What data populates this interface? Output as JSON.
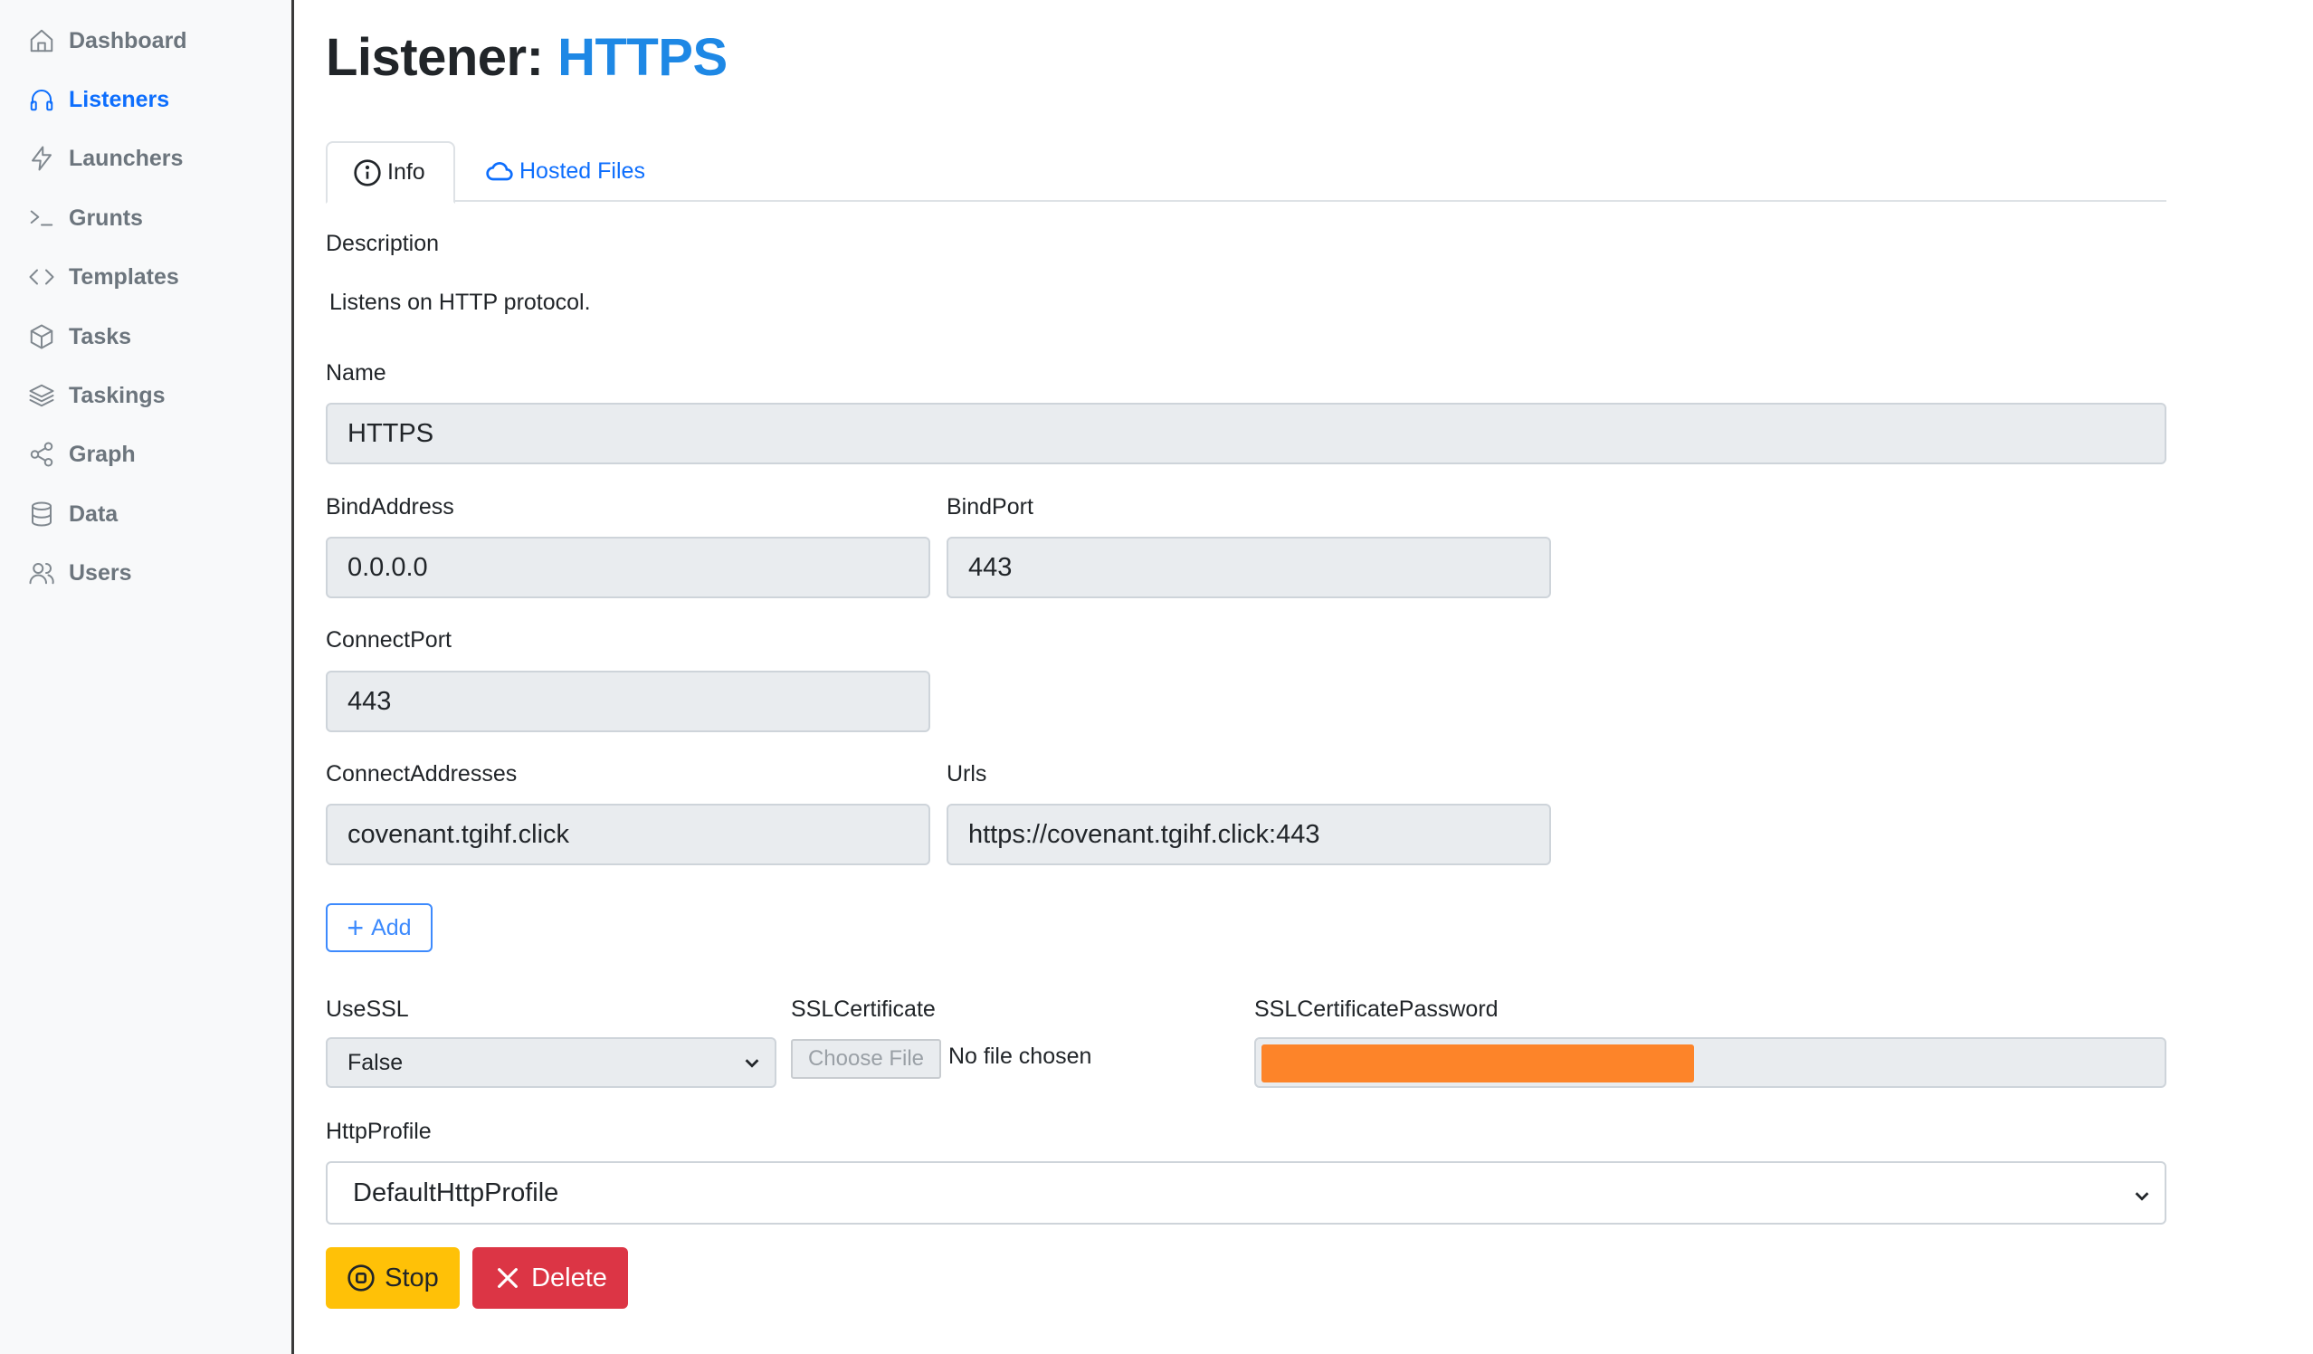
{
  "sidebar": {
    "items": [
      {
        "label": "Dashboard",
        "icon": "home-icon",
        "active": false
      },
      {
        "label": "Listeners",
        "icon": "headphones-icon",
        "active": true
      },
      {
        "label": "Launchers",
        "icon": "lightning-icon",
        "active": false
      },
      {
        "label": "Grunts",
        "icon": "terminal-icon",
        "active": false
      },
      {
        "label": "Templates",
        "icon": "code-icon",
        "active": false
      },
      {
        "label": "Tasks",
        "icon": "box-icon",
        "active": false
      },
      {
        "label": "Taskings",
        "icon": "layers-icon",
        "active": false
      },
      {
        "label": "Graph",
        "icon": "share-icon",
        "active": false
      },
      {
        "label": "Data",
        "icon": "database-icon",
        "active": false
      },
      {
        "label": "Users",
        "icon": "users-icon",
        "active": false
      }
    ]
  },
  "header": {
    "title_prefix": "Listener: ",
    "title_name": "HTTPS"
  },
  "tabs": [
    {
      "label": "Info",
      "icon": "info-icon",
      "active": true
    },
    {
      "label": "Hosted Files",
      "icon": "cloud-icon",
      "active": false
    }
  ],
  "form": {
    "description_label": "Description",
    "description_text": "Listens on HTTP protocol.",
    "name_label": "Name",
    "name_value": "HTTPS",
    "bind_address_label": "BindAddress",
    "bind_address_value": "0.0.0.0",
    "bind_port_label": "BindPort",
    "bind_port_value": "443",
    "connect_port_label": "ConnectPort",
    "connect_port_value": "443",
    "connect_addresses_label": "ConnectAddresses",
    "connect_addresses_value": "covenant.tgihf.click",
    "urls_label": "Urls",
    "urls_value": "https://covenant.tgihf.click:443",
    "add_label": "Add",
    "use_ssl_label": "UseSSL",
    "use_ssl_value": "False",
    "ssl_cert_label": "SSLCertificate",
    "choose_file_label": "Choose File",
    "file_status": "No file chosen",
    "ssl_cert_password_label": "SSLCertificatePassword",
    "http_profile_label": "HttpProfile",
    "http_profile_value": "DefaultHttpProfile"
  },
  "actions": {
    "stop_label": "Stop",
    "delete_label": "Delete"
  },
  "colors": {
    "accent": "#0d6efd",
    "title_accent": "#1e88e5",
    "stop": "#ffc107",
    "delete": "#dc3545",
    "redaction": "#fd8429"
  }
}
